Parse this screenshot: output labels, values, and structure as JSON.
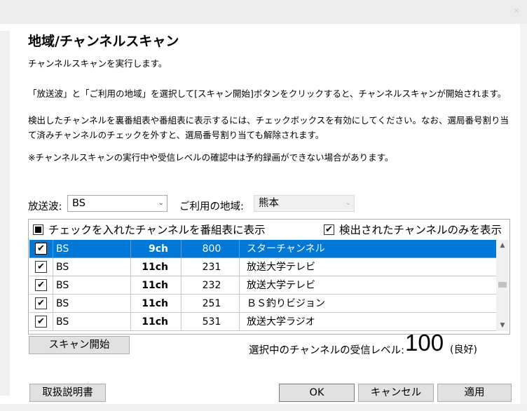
{
  "window": {
    "close_glyph": "×"
  },
  "page_title": "地域/チャンネルスキャン",
  "description": {
    "line1": "チャンネルスキャンを実行します。",
    "line2": "「放送波」と「ご利用の地域」を選択して[スキャン開始]ボタンをクリックすると、チャンネルスキャンが開始されます。",
    "line3": "検出したチャンネルを裏番組表や番組表に表示するには、チェックボックスを有効にしてください。なお、選局番号割り当て済みチャンネルのチェックを外すと、選局番号割り当ても解除されます。",
    "line4": "※チャンネルスキャンの実行中や受信レベルの確認中は予約録画ができない場合があります。"
  },
  "broadcast": {
    "label": "放送波:",
    "value": "BS"
  },
  "region": {
    "label": "ご利用の地域:",
    "value": "熊本"
  },
  "options": {
    "show_checked_label": "チェックを入れたチャンネルを番組表に表示",
    "show_checked_state": "indeterminate",
    "only_detected_label": "検出されたチャンネルのみを表示",
    "only_detected_state": "checked"
  },
  "channels": [
    {
      "checked": true,
      "wave": "BS",
      "ch": "9ch",
      "number": "800",
      "name": "スターチャンネル",
      "selected": true
    },
    {
      "checked": true,
      "wave": "BS",
      "ch": "11ch",
      "number": "231",
      "name": "放送大学テレビ",
      "selected": false
    },
    {
      "checked": true,
      "wave": "BS",
      "ch": "11ch",
      "number": "232",
      "name": "放送大学テレビ",
      "selected": false
    },
    {
      "checked": true,
      "wave": "BS",
      "ch": "11ch",
      "number": "251",
      "name": "ＢＳ釣りビジョン",
      "selected": false
    },
    {
      "checked": true,
      "wave": "BS",
      "ch": "11ch",
      "number": "531",
      "name": "放送大学ラジオ",
      "selected": false
    }
  ],
  "scan_button": "スキャン開始",
  "signal": {
    "label": "選択中のチャンネルの受信レベル:",
    "value": "100",
    "status": "(良好)"
  },
  "footer": {
    "manual": "取扱説明書",
    "ok": "OK",
    "cancel": "キャンセル",
    "apply": "適用"
  }
}
